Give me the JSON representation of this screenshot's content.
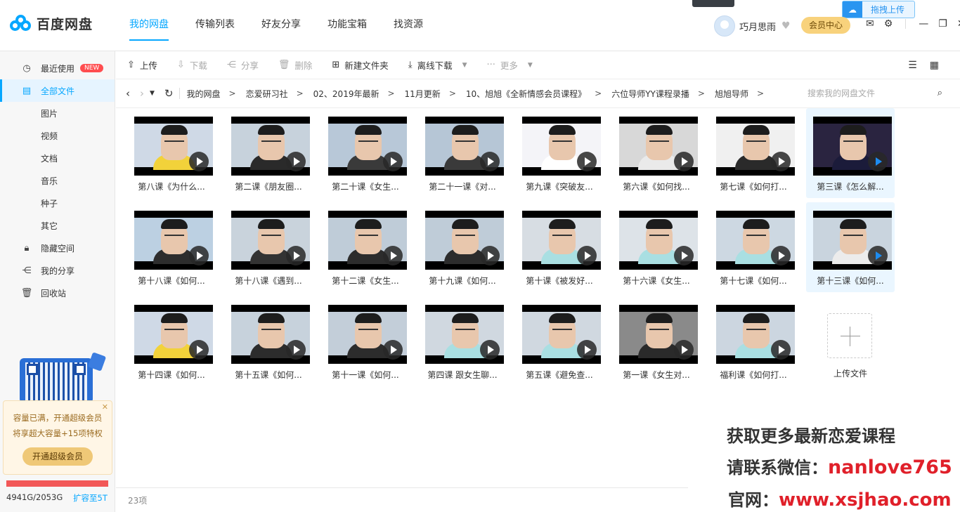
{
  "app": {
    "name": "百度网盘"
  },
  "nav": {
    "tabs": [
      "我的网盘",
      "传输列表",
      "好友分享",
      "功能宝箱",
      "找资源"
    ],
    "active": 0
  },
  "header": {
    "username": "巧月思雨",
    "vip_label": "会员中心",
    "drag_upload": "拖拽上传"
  },
  "sidebar": {
    "items": [
      {
        "label": "最近使用",
        "icon": "clock-icon",
        "badge": "NEW"
      },
      {
        "label": "全部文件",
        "icon": "document-icon",
        "active": true
      },
      {
        "label": "图片"
      },
      {
        "label": "视频"
      },
      {
        "label": "文档"
      },
      {
        "label": "音乐"
      },
      {
        "label": "种子"
      },
      {
        "label": "其它"
      },
      {
        "label": "隐藏空间",
        "icon": "lock-icon"
      },
      {
        "label": "我的分享",
        "icon": "share-icon"
      },
      {
        "label": "回收站",
        "icon": "trash-icon"
      }
    ],
    "promo": {
      "line1": "容量已满，开通超级会员",
      "line2": "将享超大容量+15项特权",
      "button": "开通超级会员"
    },
    "quota": {
      "text": "4941G/2053G",
      "link": "扩容至5T",
      "used_fraction": 1.0
    }
  },
  "toolbar": {
    "upload": "上传",
    "download": "下载",
    "share": "分享",
    "delete": "删除",
    "new_folder": "新建文件夹",
    "offline_download": "离线下载",
    "more": "更多"
  },
  "breadcrumb": {
    "items": [
      "我的网盘",
      "恋爱研习社",
      "02、2019年最新",
      "11月更新",
      "10、旭旭《全新情感会员课程》",
      "六位导师YY课程录播",
      "旭旭导师"
    ],
    "search_placeholder": "搜索我的网盘文件"
  },
  "files": [
    {
      "name": "第八课《为什么...",
      "shirt": "#f2d23a",
      "bg": "#cfd9e6"
    },
    {
      "name": "第二课《朋友圈...",
      "shirt": "#2a2a2a",
      "bg": "#c7d2dc"
    },
    {
      "name": "第二十课《女生...",
      "shirt": "#3a3a3a",
      "bg": "#b8c8d8"
    },
    {
      "name": "第二十一课《对...",
      "shirt": "#3a3a3a",
      "bg": "#b6c6d6"
    },
    {
      "name": "第九课《突破友...",
      "shirt": "#ffffff",
      "bg": "#f4f4f8"
    },
    {
      "name": "第六课《如何找...",
      "shirt": "#eaeaea",
      "bg": "#d8d8d8"
    },
    {
      "name": "第七课《如何打...",
      "shirt": "#2a2a2a",
      "bg": "#f0f0f0"
    },
    {
      "name": "第三课《怎么解...",
      "shirt": "#1b1b3a",
      "bg": "#2a2440",
      "selected": true,
      "blue": true
    },
    {
      "name": "第十八课《如何...",
      "shirt": "#2d2d2d",
      "bg": "#bcd0e2"
    },
    {
      "name": "第十八课《遇到...",
      "shirt": "#333333",
      "bg": "#c9d3dc"
    },
    {
      "name": "第十二课《女生...",
      "shirt": "#2c2c2c",
      "bg": "#bfccd8"
    },
    {
      "name": "第十九课《如何...",
      "shirt": "#2c2c2c",
      "bg": "#bfccd8"
    },
    {
      "name": "第十课《被发好...",
      "shirt": "#a9dfe2",
      "bg": "#d7dde3"
    },
    {
      "name": "第十六课《女生...",
      "shirt": "#a9dfe2",
      "bg": "#dde3e8"
    },
    {
      "name": "第十七课《如何...",
      "shirt": "#a9dfe2",
      "bg": "#cdd8e2"
    },
    {
      "name": "第十三课《如何...",
      "shirt": "#ececec",
      "bg": "#c9d4de",
      "selected": true,
      "blue": true
    },
    {
      "name": "第十四课《如何...",
      "shirt": "#f2d23a",
      "bg": "#cfd9e6"
    },
    {
      "name": "第十五课《如何...",
      "shirt": "#2c2c2c",
      "bg": "#c7d2dc"
    },
    {
      "name": "第十一课《如何...",
      "shirt": "#2c2c2c",
      "bg": "#c3ced9"
    },
    {
      "name": "第四课 跟女生聊...",
      "shirt": "#a9dfe2",
      "bg": "#d0d8e0"
    },
    {
      "name": "第五课《避免查...",
      "shirt": "#a9dfe2",
      "bg": "#d0d8e0"
    },
    {
      "name": "第一课《女生对...",
      "shirt": "#2a2a2a",
      "bg": "#8a8a8a"
    },
    {
      "name": "福利课《如何打...",
      "shirt": "#a9dfe2",
      "bg": "#ccd6e0"
    }
  ],
  "upload_tile": {
    "label": "上传文件"
  },
  "footer": {
    "count": "23项"
  },
  "watermark": {
    "line1": "获取更多最新恋爱课程",
    "line2_prefix": "请联系微信：",
    "line2_value": "nanlove765",
    "line3_prefix": "官网：",
    "line3_value": "www.xsjhao.com"
  },
  "colors": {
    "accent": "#06a7ff",
    "vip": "#f8d27c",
    "quota_full": "#f25858",
    "watermark_red": "#e0202a"
  }
}
